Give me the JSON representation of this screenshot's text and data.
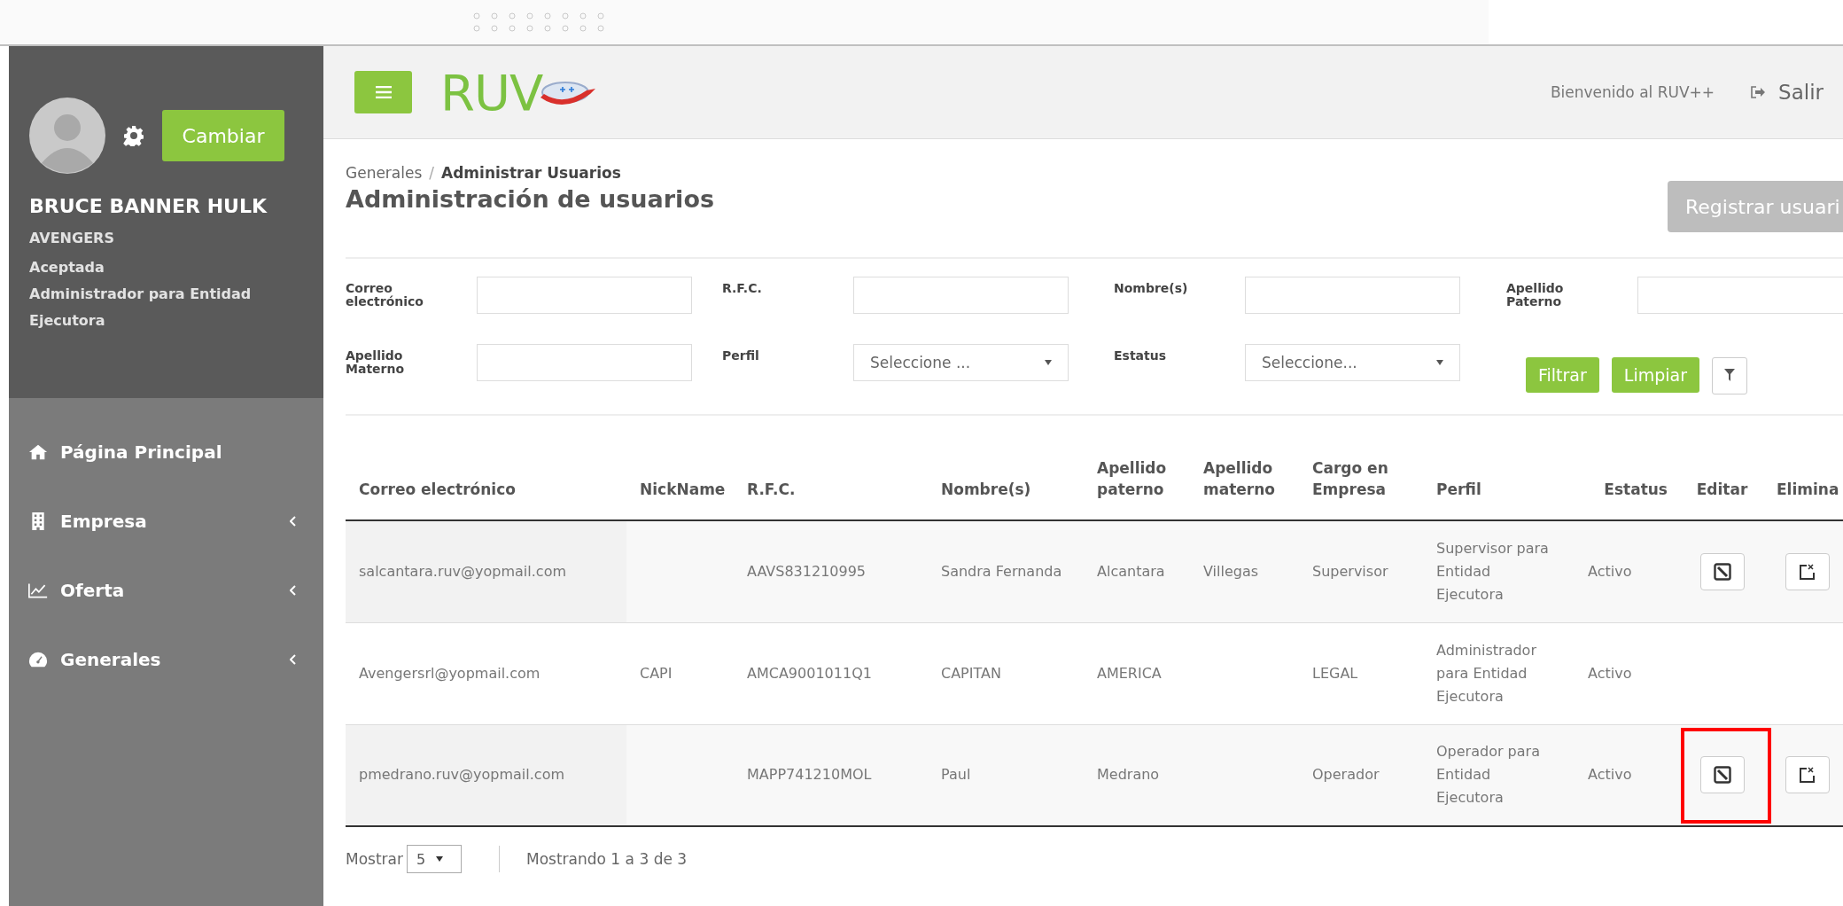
{
  "sidebar": {
    "change_button": "Cambiar",
    "user_name": "BRUCE BANNER HULK",
    "organization": "AVENGERS",
    "status": "Aceptada",
    "role": "Administrador para Entidad Ejecutora",
    "menu": [
      {
        "label": "Página Principal",
        "kind": "home",
        "has_submenu": false
      },
      {
        "label": "Empresa",
        "kind": "building",
        "has_submenu": true
      },
      {
        "label": "Oferta",
        "kind": "chart",
        "has_submenu": true
      },
      {
        "label": "Generales",
        "kind": "dashboard",
        "has_submenu": true
      }
    ]
  },
  "header": {
    "logo_text": "RUV",
    "welcome": "Bienvenido al RUV++",
    "logout": "Salir"
  },
  "breadcrumb": {
    "parent": "Generales",
    "separator": "/",
    "current": "Administrar Usuarios"
  },
  "page_title": "Administración de usuarios",
  "register_button": "Registrar usuari",
  "filters": [
    {
      "label": "Correo electrónico",
      "kind": "text"
    },
    {
      "label": "R.F.C.",
      "kind": "text"
    },
    {
      "label": "Nombre(s)",
      "kind": "text"
    },
    {
      "label": "Apellido Paterno",
      "kind": "text"
    },
    {
      "label": "Apellido Materno",
      "kind": "text"
    },
    {
      "label": "Perfil",
      "kind": "select",
      "placeholder": "Seleccione ..."
    },
    {
      "label": "Estatus",
      "kind": "select",
      "placeholder": "Seleccione..."
    }
  ],
  "filter_buttons": [
    "Filtrar",
    "Limpiar"
  ],
  "table": {
    "columns": [
      "Correo electrónico",
      "NickName",
      "R.F.C.",
      "Nombre(s)",
      "Apellido paterno",
      "Apellido materno",
      "Cargo en Empresa",
      "Perfil",
      "Estatus",
      "Editar",
      "Elimina"
    ],
    "rows": [
      {
        "cells": [
          "salcantara.ruv@yopmail.com",
          "",
          "AAVS831210995",
          "Sandra Fernanda",
          "Alcantara",
          "Villegas",
          "Supervisor",
          "Supervisor para Entidad Ejecutora",
          "Activo"
        ],
        "actions": true,
        "highlighted": false
      },
      {
        "cells": [
          "Avengersrl@yopmail.com",
          "CAPI",
          "AMCA9001011Q1",
          "CAPITAN",
          "AMERICA",
          "",
          "LEGAL",
          "Administrador para Entidad Ejecutora",
          "Activo"
        ],
        "actions": false,
        "highlighted": false
      },
      {
        "cells": [
          "pmedrano.ruv@yopmail.com",
          "",
          "MAPP741210MOL",
          "Paul",
          "Medrano",
          "",
          "Operador",
          "Operador para Entidad Ejecutora",
          "Activo"
        ],
        "actions": true,
        "highlighted": true
      }
    ]
  },
  "pagination": {
    "show_label": "Mostrar",
    "page_size": "5",
    "summary": "Mostrando 1 a 3 de 3"
  }
}
